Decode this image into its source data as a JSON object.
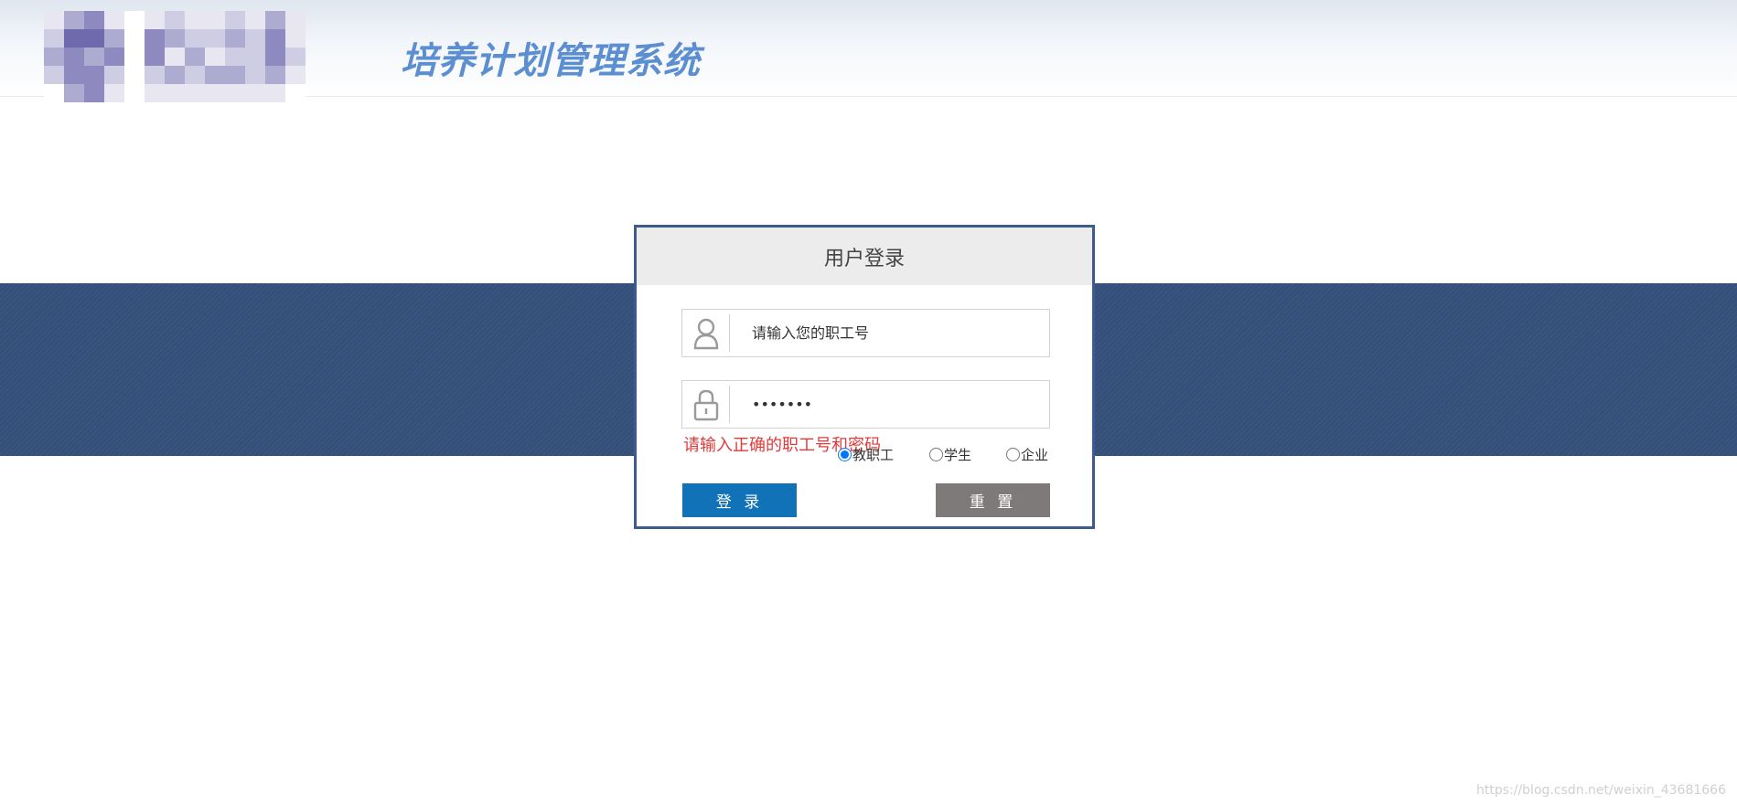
{
  "header": {
    "system_title": "培养计划管理系统"
  },
  "login": {
    "title": "用户登录",
    "username_placeholder": "请输入您的职工号",
    "password_value": "•••••••",
    "error_message": "请输入正确的职工号和密码",
    "roles": [
      {
        "label": "教职工",
        "checked": true
      },
      {
        "label": "学生",
        "checked": false
      },
      {
        "label": "企业",
        "checked": false
      }
    ],
    "login_button": "登 录",
    "reset_button": "重 置"
  },
  "watermark": "https://blog.csdn.net/weixin_43681666",
  "colors": {
    "band": "#34507a",
    "panel_border": "#3d5c8d",
    "login_button": "#1172b7",
    "reset_button": "#7e7a79",
    "error": "#e23a3a",
    "title": "#5b8fd1"
  },
  "icons": {
    "user": "user-icon",
    "password": "lock-icon"
  }
}
